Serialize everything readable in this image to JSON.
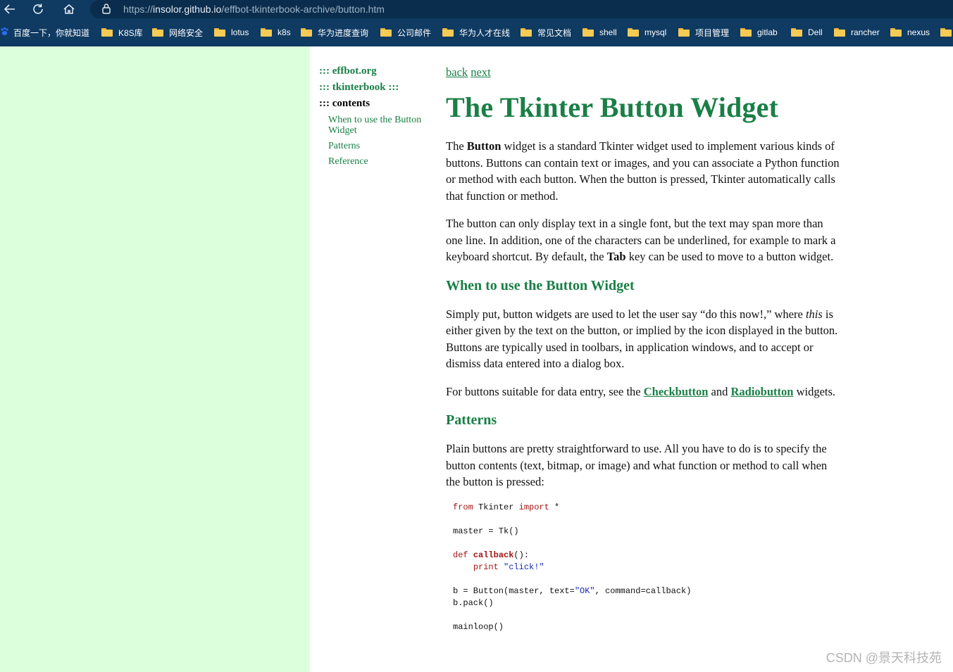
{
  "browser": {
    "url_scheme": "https://",
    "url_host": "insolor.github.io",
    "url_path": "/effbot-tkinterbook-archive/button.htm",
    "bookmarks": [
      {
        "label": "百度一下，你就知道",
        "icon": "paw-icon"
      },
      {
        "label": "K8S库",
        "icon": "folder-icon"
      },
      {
        "label": "网络安全",
        "icon": "folder-icon"
      },
      {
        "label": "lotus",
        "icon": "folder-icon"
      },
      {
        "label": "k8s",
        "icon": "folder-icon"
      },
      {
        "label": "华为进度查询",
        "icon": "folder-icon"
      },
      {
        "label": "公司邮件",
        "icon": "folder-icon"
      },
      {
        "label": "华为人才在线",
        "icon": "folder-icon"
      },
      {
        "label": "常见文档",
        "icon": "folder-icon"
      },
      {
        "label": "shell",
        "icon": "folder-icon"
      },
      {
        "label": "mysql",
        "icon": "folder-icon"
      },
      {
        "label": "项目管理",
        "icon": "folder-icon"
      },
      {
        "label": "gitlab",
        "icon": "folder-icon"
      },
      {
        "label": "Dell",
        "icon": "folder-icon"
      },
      {
        "label": "rancher",
        "icon": "folder-icon"
      },
      {
        "label": "nexus",
        "icon": "folder-icon"
      }
    ]
  },
  "sidebar": {
    "effbot": "::: effbot.org",
    "tkinterbook": "::: tkinterbook :::",
    "contents": "::: contents",
    "items": [
      "When to use the Button Widget",
      "Patterns",
      "Reference"
    ]
  },
  "page": {
    "back": "back",
    "next": "next",
    "title": "The Tkinter Button Widget",
    "intro": {
      "p1_a": "The ",
      "p1_bold": "Button",
      "p1_b": " widget is a standard Tkinter widget used to implement various kinds of buttons. Buttons can contain text or images, and you can associate a Python function or method with each button. When the button is pressed, Tkinter automatically calls that function or method.",
      "p2_a": "The button can only display text in a single font, but the text may span more than one line. In addition, one of the characters can be underlined, for example to mark a keyboard shortcut. By default, the ",
      "p2_bold": "Tab",
      "p2_b": " key can be used to move to a button widget."
    },
    "when": {
      "heading": "When to use the Button Widget",
      "p1_a": "Simply put, button widgets are used to let the user say “do this now!,” where ",
      "p1_em": "this",
      "p1_b": " is either given by the text on the button, or implied by the icon displayed in the button. Buttons are typically used in toolbars, in application windows, and to accept or dismiss data entered into a dialog box.",
      "p2_a": "For buttons suitable for data entry, see the ",
      "p2_link1": "Checkbutton",
      "p2_mid": " and ",
      "p2_link2": "Radiobutton",
      "p2_b": " widgets."
    },
    "patterns": {
      "heading": "Patterns",
      "p1": "Plain buttons are pretty straightforward to use. All you have to do is to specify the button contents (text, bitmap, or image) and what function or method to call when the button is pressed:"
    },
    "code": {
      "l1_kw1": "from",
      "l1_mid": " Tkinter ",
      "l1_kw2": "import",
      "l1_end": " *",
      "l2": "master = Tk()",
      "l3_kw": "def",
      "l3_fn": "callback",
      "l3_end": "():",
      "l4_kw": "print",
      "l4_str": "\"click!\"",
      "l5_a": "b = Button(master, text=",
      "l5_str": "\"OK\"",
      "l5_b": ", command=callback)",
      "l6": "b.pack()",
      "l7": "mainloop()"
    }
  },
  "watermark": "CSDN @景天科技苑",
  "colors": {
    "accent": "#1a7f46",
    "sidebar_bg": "#dcffdc",
    "chrome_bg": "#0f3a62"
  }
}
